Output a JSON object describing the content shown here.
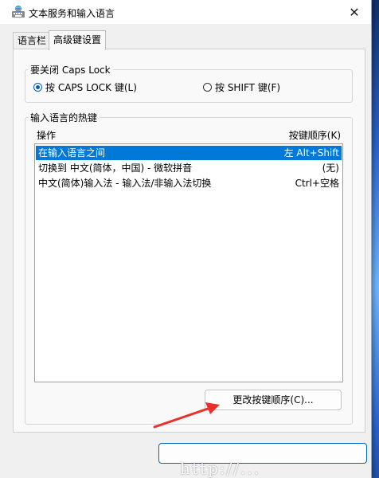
{
  "window": {
    "title": "文本服务和输入语言",
    "close_glyph": "✕"
  },
  "tabs": [
    {
      "label": "语言栏",
      "active": false
    },
    {
      "label": "高级键设置",
      "active": true
    }
  ],
  "caps_lock": {
    "legend": "要关闭 Caps Lock",
    "options": [
      {
        "label": "按 CAPS LOCK 键(L)",
        "checked": true
      },
      {
        "label": "按 SHIFT 键(F)",
        "checked": false
      }
    ]
  },
  "hotkeys": {
    "legend": "输入语言的热键",
    "col_action": "操作",
    "col_keys": "按键顺序(K)",
    "rows": [
      {
        "action": "在输入语言之间",
        "keys": "左 Alt+Shift",
        "selected": true
      },
      {
        "action": "切换到 中文(简体，中国) - 微软拼音",
        "keys": "(无)",
        "selected": false
      },
      {
        "action": "中文(简体)输入法 - 输入法/非输入法切换",
        "keys": "Ctrl+空格",
        "selected": false
      }
    ],
    "change_button": "更改按键顺序(C)..."
  },
  "annotation_color": "#e8312a",
  "watermark": "http://..."
}
